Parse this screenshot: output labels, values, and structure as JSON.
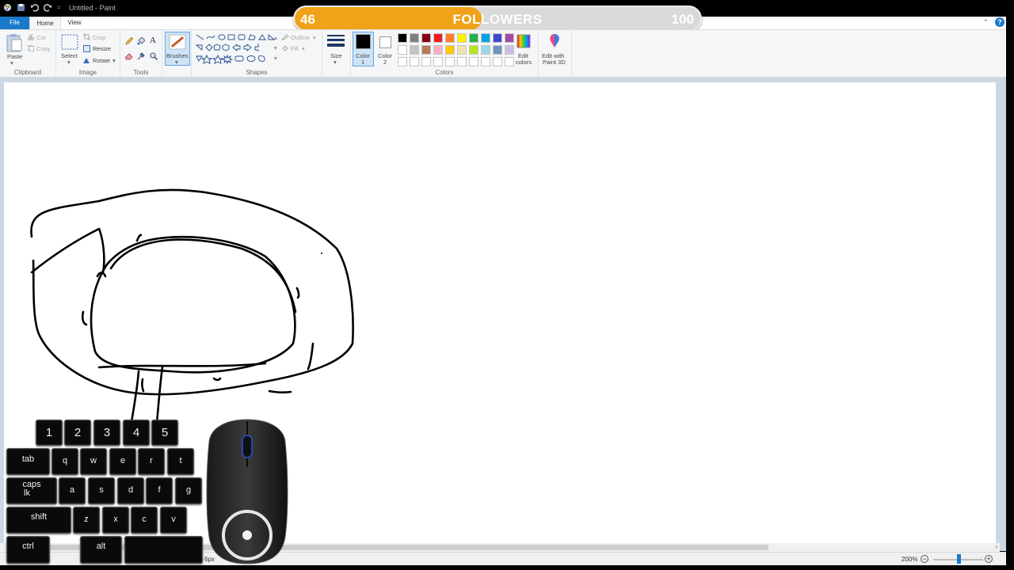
{
  "window": {
    "title": "Untitled - Paint"
  },
  "overlay": {
    "followers_current": "46",
    "followers_label": "FOLLOWERS",
    "followers_goal": "100",
    "progress": 0.46,
    "fill_color": "#f0a318"
  },
  "tabs": {
    "file": "File",
    "home": "Home",
    "view": "View"
  },
  "ribbon": {
    "clipboard": {
      "paste": "Paste",
      "cut": "Cut",
      "copy": "Copy",
      "label": "Clipboard"
    },
    "image": {
      "select": "Select",
      "crop": "Crop",
      "resize": "Resize",
      "rotate": "Rotate",
      "label": "Image"
    },
    "tools": {
      "label": "Tools"
    },
    "brushes": {
      "label": "Brushes"
    },
    "shapes": {
      "outline": "Outline",
      "fill": "Fill",
      "label": "Shapes"
    },
    "size": {
      "label": "Size"
    },
    "colors": {
      "color1_line1": "Color",
      "color1_line2": "1",
      "color2_line1": "Color",
      "color2_line2": "2",
      "edit_line1": "Edit",
      "edit_line2": "colors",
      "paint3d_line1": "Edit with",
      "paint3d_line2": "Paint 3D",
      "label": "Colors",
      "palette": [
        "#000000",
        "#7f7f7f",
        "#880015",
        "#ed1c24",
        "#ff7f27",
        "#fff200",
        "#22b14c",
        "#00a2e8",
        "#3f48cc",
        "#a349a4",
        "#ffffff",
        "#c3c3c3",
        "#b97a57",
        "#ffaec9",
        "#ffc90e",
        "#efe4b0",
        "#b5e61d",
        "#99d9ea",
        "#7092be",
        "#c8bfe7",
        "#ffffff",
        "#ffffff",
        "#ffffff",
        "#ffffff",
        "#ffffff",
        "#ffffff",
        "#ffffff",
        "#ffffff",
        "#ffffff",
        "#ffffff"
      ],
      "color1": "#000000",
      "color2": "#ffffff"
    }
  },
  "status": {
    "zoom": "200%",
    "size_fragment": "6px"
  },
  "keyboard": {
    "numbers": [
      "1",
      "2",
      "3",
      "4",
      "5"
    ],
    "row1": [
      "tab",
      "q",
      "w",
      "e",
      "r",
      "t"
    ],
    "caps_line1": "caps",
    "caps_line2": "lk",
    "row2": [
      "a",
      "s",
      "d",
      "f",
      "g"
    ],
    "shift": "shift",
    "row3": [
      "z",
      "x",
      "c",
      "v"
    ],
    "ctrl": "ctrl",
    "alt": "alt"
  }
}
